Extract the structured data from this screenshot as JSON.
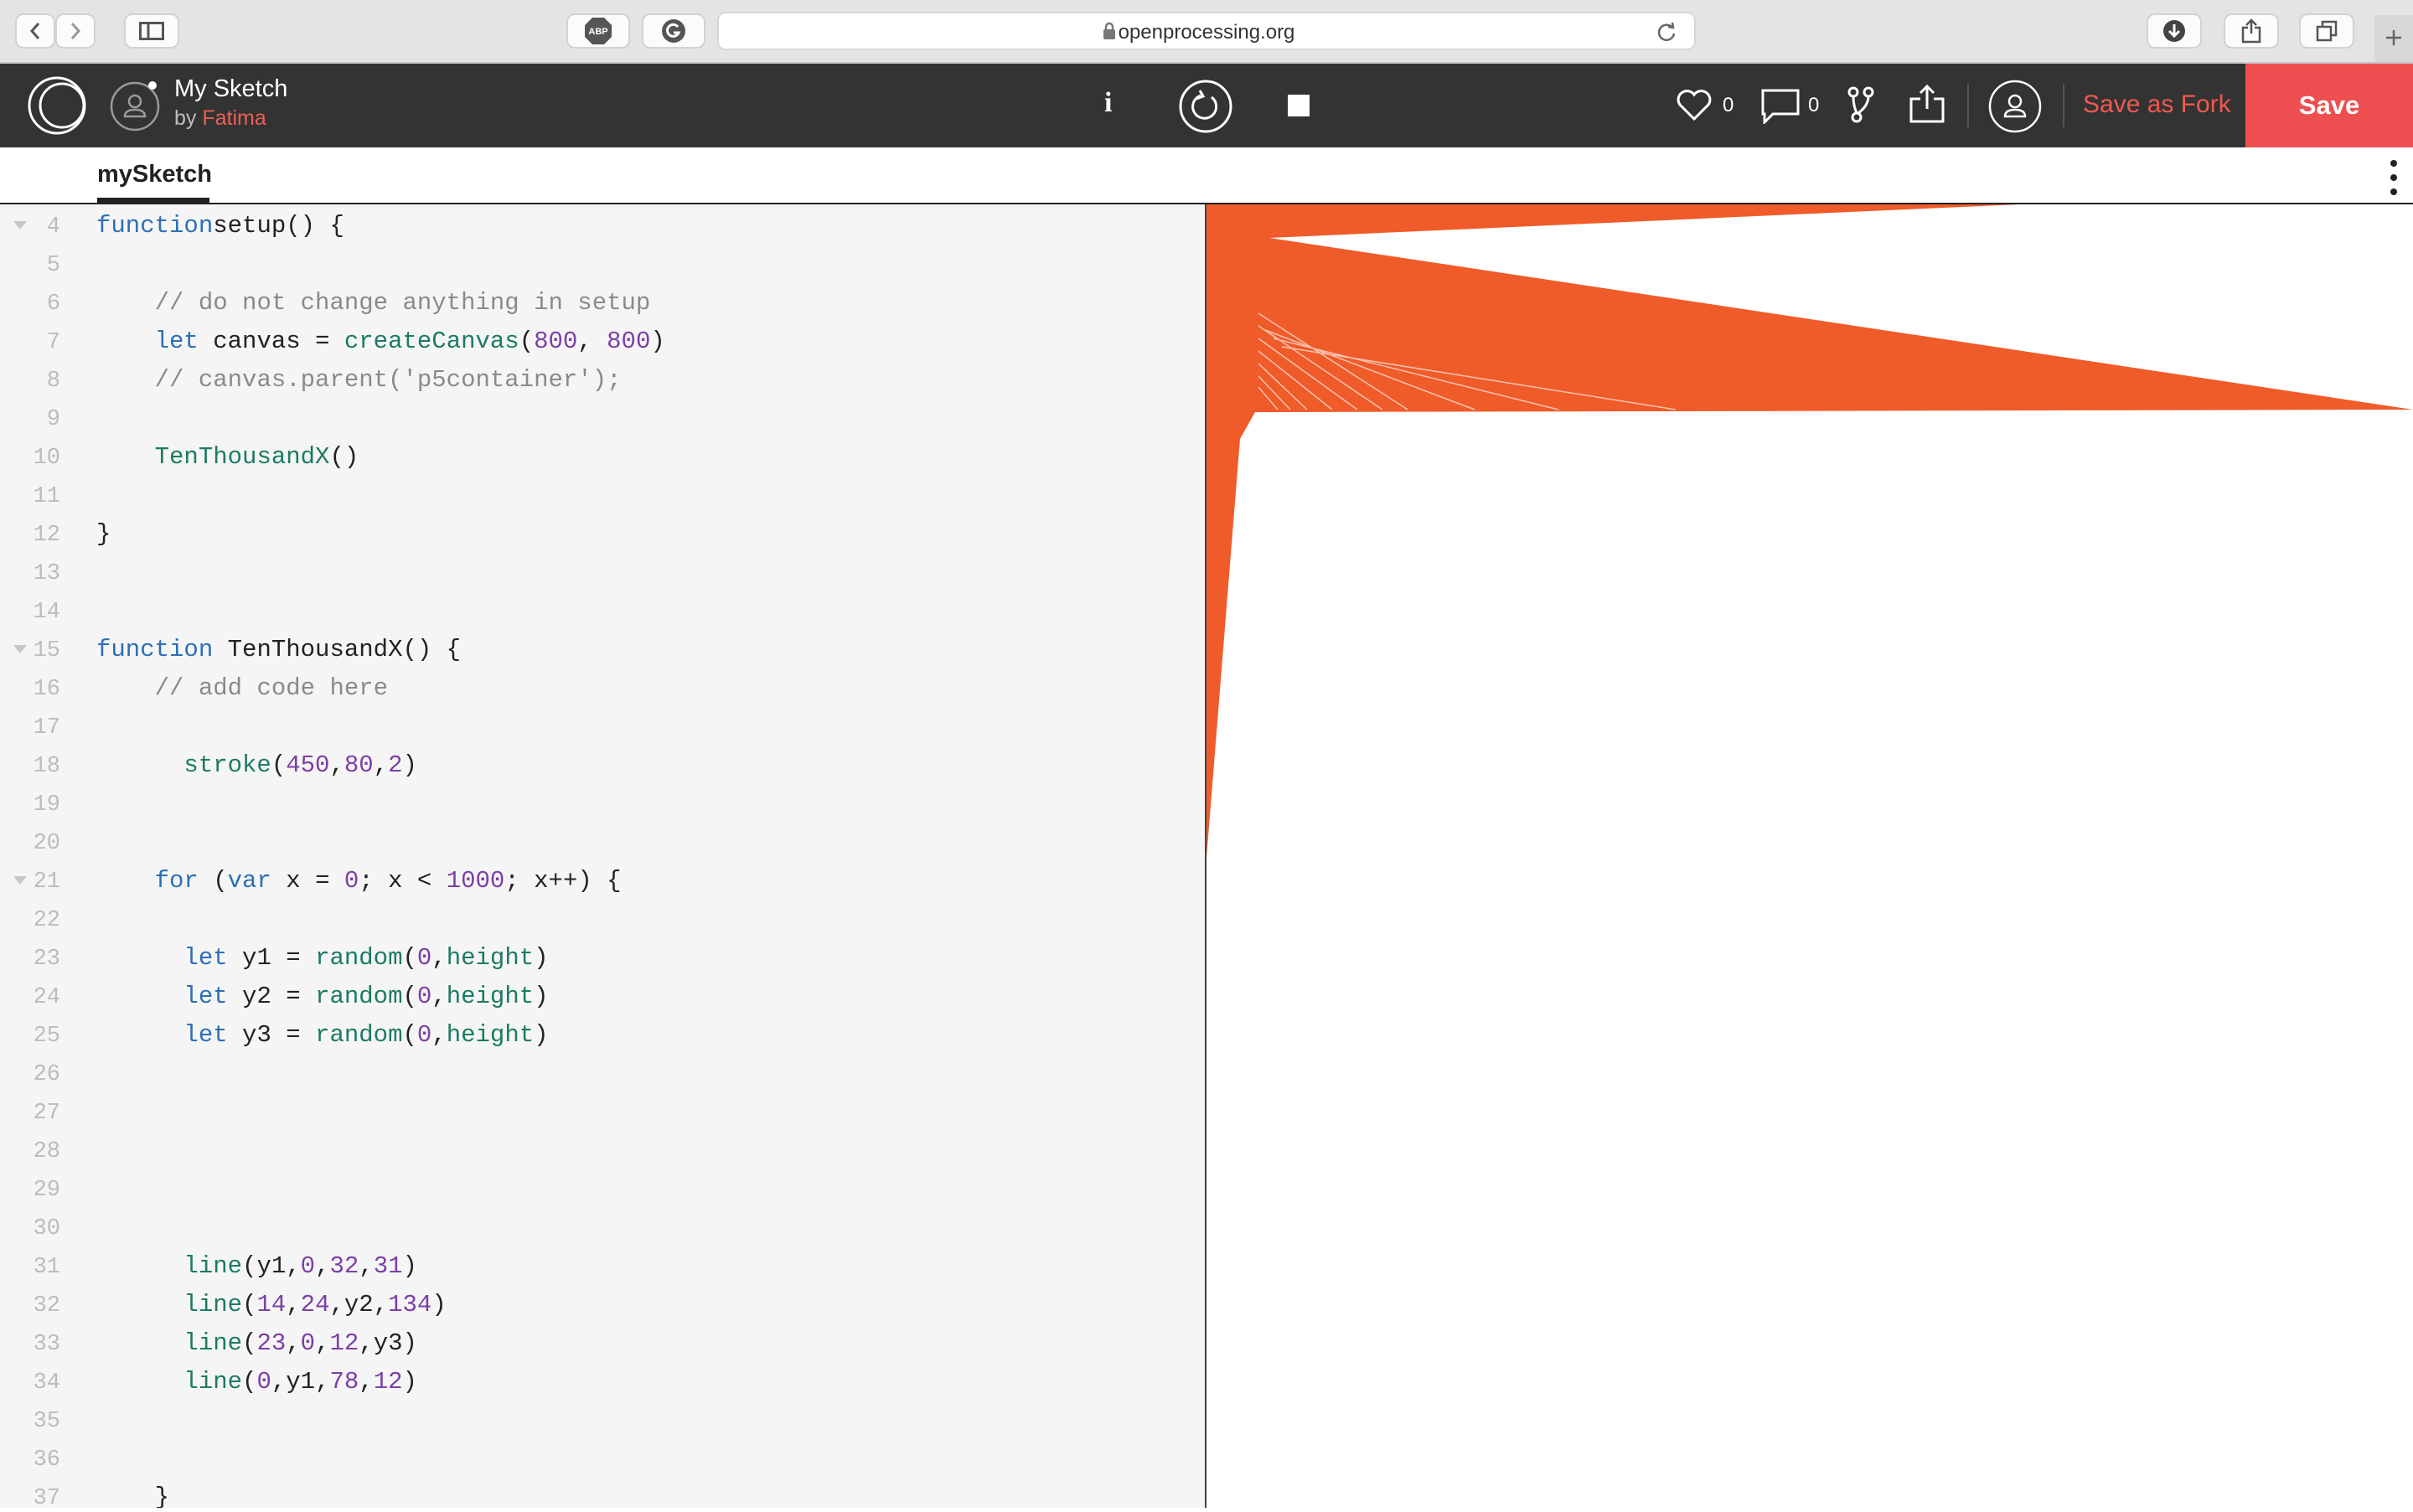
{
  "browser": {
    "url": "openprocessing.org"
  },
  "header": {
    "title": "My Sketch",
    "by_prefix": "by",
    "author": "Fatima",
    "likes": "0",
    "comments": "0",
    "save_as_fork": "Save as Fork",
    "save": "Save",
    "info": "i"
  },
  "tab": {
    "label": "mySketch"
  },
  "code_lines": [
    {
      "n": "4",
      "fold": true,
      "t": [
        [
          "kw",
          "function"
        ],
        [
          "",
          "setup() {"
        ]
      ]
    },
    {
      "n": "5",
      "t": []
    },
    {
      "n": "6",
      "t": [
        [
          "",
          "    "
        ],
        [
          "cm",
          "// do not change anything in setup"
        ]
      ]
    },
    {
      "n": "7",
      "t": [
        [
          "",
          "    "
        ],
        [
          "kw",
          "let"
        ],
        [
          "",
          " canvas = "
        ],
        [
          "fn",
          "createCanvas"
        ],
        [
          "",
          "("
        ],
        [
          "nm",
          "800"
        ],
        [
          "",
          ", "
        ],
        [
          "nm",
          "800"
        ],
        [
          "",
          ")"
        ]
      ]
    },
    {
      "n": "8",
      "t": [
        [
          "",
          "    "
        ],
        [
          "cm",
          "// canvas.parent('p5container');"
        ]
      ]
    },
    {
      "n": "9",
      "t": []
    },
    {
      "n": "10",
      "t": [
        [
          "",
          "    "
        ],
        [
          "fn",
          "TenThousandX"
        ],
        [
          "",
          "()"
        ]
      ]
    },
    {
      "n": "11",
      "t": []
    },
    {
      "n": "12",
      "t": [
        [
          "",
          "}"
        ]
      ]
    },
    {
      "n": "13",
      "t": []
    },
    {
      "n": "14",
      "t": []
    },
    {
      "n": "15",
      "fold": true,
      "t": [
        [
          "kw",
          "function"
        ],
        [
          "",
          " TenThousandX() {"
        ]
      ]
    },
    {
      "n": "16",
      "t": [
        [
          "",
          "    "
        ],
        [
          "cm",
          "// add code here"
        ]
      ]
    },
    {
      "n": "17",
      "t": []
    },
    {
      "n": "18",
      "t": [
        [
          "",
          "      "
        ],
        [
          "fn",
          "stroke"
        ],
        [
          "",
          "("
        ],
        [
          "nm",
          "450"
        ],
        [
          "",
          ","
        ],
        [
          "nm",
          "80"
        ],
        [
          "",
          ","
        ],
        [
          "nm",
          "2"
        ],
        [
          "",
          ")"
        ]
      ]
    },
    {
      "n": "19",
      "t": []
    },
    {
      "n": "20",
      "t": []
    },
    {
      "n": "21",
      "fold": true,
      "t": [
        [
          "",
          "    "
        ],
        [
          "kw",
          "for"
        ],
        [
          "",
          " ("
        ],
        [
          "kw",
          "var"
        ],
        [
          "",
          " x = "
        ],
        [
          "nm",
          "0"
        ],
        [
          "",
          "; x < "
        ],
        [
          "nm",
          "1000"
        ],
        [
          "",
          "; x++) {"
        ]
      ]
    },
    {
      "n": "22",
      "t": []
    },
    {
      "n": "23",
      "t": [
        [
          "",
          "      "
        ],
        [
          "kw",
          "let"
        ],
        [
          "",
          " y1 = "
        ],
        [
          "fn",
          "random"
        ],
        [
          "",
          "("
        ],
        [
          "nm",
          "0"
        ],
        [
          "",
          ","
        ],
        [
          "fn",
          "height"
        ],
        [
          "",
          ")"
        ]
      ]
    },
    {
      "n": "24",
      "t": [
        [
          "",
          "      "
        ],
        [
          "kw",
          "let"
        ],
        [
          "",
          " y2 = "
        ],
        [
          "fn",
          "random"
        ],
        [
          "",
          "("
        ],
        [
          "nm",
          "0"
        ],
        [
          "",
          ","
        ],
        [
          "fn",
          "height"
        ],
        [
          "",
          ")"
        ]
      ]
    },
    {
      "n": "25",
      "t": [
        [
          "",
          "      "
        ],
        [
          "kw",
          "let"
        ],
        [
          "",
          " y3 = "
        ],
        [
          "fn",
          "random"
        ],
        [
          "",
          "("
        ],
        [
          "nm",
          "0"
        ],
        [
          "",
          ","
        ],
        [
          "fn",
          "height"
        ],
        [
          "",
          ")"
        ]
      ]
    },
    {
      "n": "26",
      "t": []
    },
    {
      "n": "27",
      "t": []
    },
    {
      "n": "28",
      "t": []
    },
    {
      "n": "29",
      "t": []
    },
    {
      "n": "30",
      "t": []
    },
    {
      "n": "31",
      "t": [
        [
          "",
          "      "
        ],
        [
          "fn",
          "line"
        ],
        [
          "",
          "(y1,"
        ],
        [
          "nm",
          "0"
        ],
        [
          "",
          ","
        ],
        [
          "nm",
          "32"
        ],
        [
          "",
          ","
        ],
        [
          "nm",
          "31"
        ],
        [
          "",
          ")"
        ]
      ]
    },
    {
      "n": "32",
      "t": [
        [
          "",
          "      "
        ],
        [
          "fn",
          "line"
        ],
        [
          "",
          "("
        ],
        [
          "nm",
          "14"
        ],
        [
          "",
          ","
        ],
        [
          "nm",
          "24"
        ],
        [
          "",
          ",y2,"
        ],
        [
          "nm",
          "134"
        ],
        [
          "",
          ")"
        ]
      ]
    },
    {
      "n": "33",
      "t": [
        [
          "",
          "      "
        ],
        [
          "fn",
          "line"
        ],
        [
          "",
          "("
        ],
        [
          "nm",
          "23"
        ],
        [
          "",
          ","
        ],
        [
          "nm",
          "0"
        ],
        [
          "",
          ","
        ],
        [
          "nm",
          "12"
        ],
        [
          "",
          ",y3)"
        ]
      ]
    },
    {
      "n": "34",
      "t": [
        [
          "",
          "      "
        ],
        [
          "fn",
          "line"
        ],
        [
          "",
          "("
        ],
        [
          "nm",
          "0"
        ],
        [
          "",
          ",y1,"
        ],
        [
          "nm",
          "78"
        ],
        [
          "",
          ","
        ],
        [
          "nm",
          "12"
        ],
        [
          "",
          ")"
        ]
      ]
    },
    {
      "n": "35",
      "t": []
    },
    {
      "n": "36",
      "t": []
    },
    {
      "n": "37",
      "t": [
        [
          "",
          "    }"
        ]
      ]
    }
  ],
  "colors": {
    "accent": "#ed4f50",
    "sketch_stroke": "#ef5b29"
  }
}
